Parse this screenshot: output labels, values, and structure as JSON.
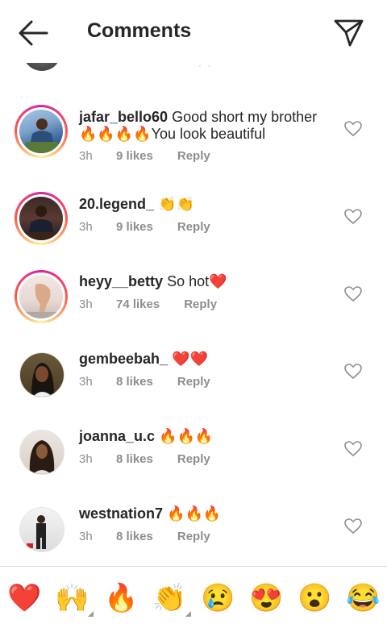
{
  "header": {
    "title": "Comments"
  },
  "comments": [
    {
      "username": "jafar_bello60",
      "text": "Good short my brother 🔥🔥🔥🔥You look beautiful",
      "time": "3h",
      "likes": "9 likes",
      "reply": "Reply"
    },
    {
      "username": "20.legend_",
      "text": "👏👏",
      "time": "3h",
      "likes": "9 likes",
      "reply": "Reply"
    },
    {
      "username": "heyy__betty",
      "text": "So hot❤️",
      "time": "3h",
      "likes": "74 likes",
      "reply": "Reply"
    },
    {
      "username": "gembeebah_",
      "text": "❤️❤️",
      "time": "3h",
      "likes": "8 likes",
      "reply": "Reply"
    },
    {
      "username": "joanna_u.c",
      "text": "🔥🔥🔥",
      "time": "3h",
      "likes": "8 likes",
      "reply": "Reply"
    },
    {
      "username": "westnation7",
      "text": "🔥🔥🔥",
      "time": "3h",
      "likes": "8 likes",
      "reply": "Reply"
    }
  ],
  "quick_reactions": [
    "❤️",
    "🙌",
    "🔥",
    "👏",
    "😢",
    "😍",
    "😮",
    "😂"
  ],
  "colors": {
    "text": "#262626",
    "secondary": "#8e8e8e",
    "heart": "#ed4956"
  }
}
